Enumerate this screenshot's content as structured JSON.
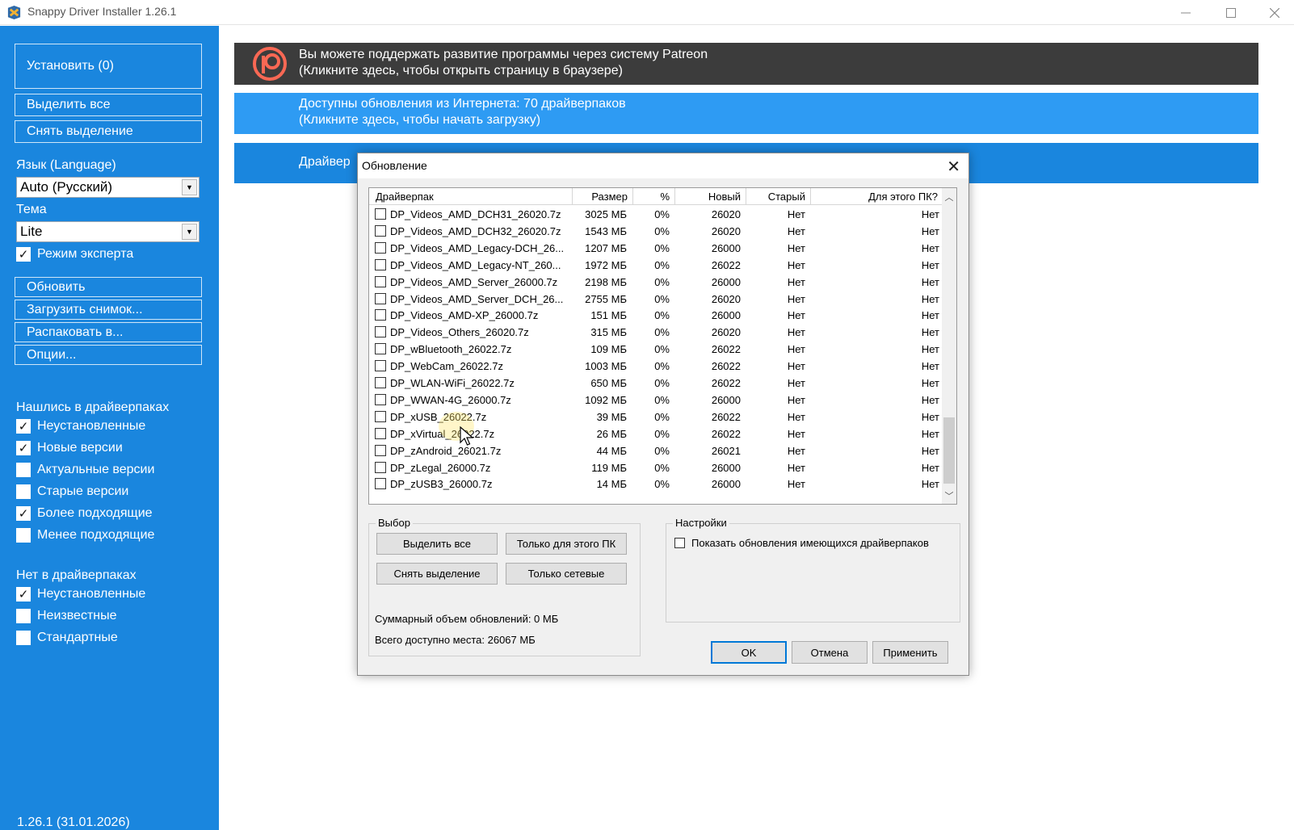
{
  "window": {
    "title": "Snappy Driver Installer 1.26.1",
    "minimize_icon": "minimize-icon",
    "maximize_icon": "maximize-icon",
    "close_icon": "close-icon"
  },
  "sidebar": {
    "install_label": "Установить (0)",
    "select_all_label": "Выделить все",
    "deselect_label": "Снять выделение",
    "language_label": "Язык (Language)",
    "language_value": "Auto (Русский)",
    "theme_label": "Тема",
    "theme_value": "Lite",
    "expert_mode_label": "Режим эксперта",
    "expert_mode_checked": true,
    "refresh_label": "Обновить",
    "load_snapshot_label": "Загрузить снимок...",
    "extract_label": "Распаковать в...",
    "options_label": "Опции...",
    "found_header": "Нашлись в драйверпаках",
    "found_filters": [
      {
        "label": "Неустановленные",
        "checked": true
      },
      {
        "label": "Новые версии",
        "checked": true
      },
      {
        "label": "Актуальные версии",
        "checked": false
      },
      {
        "label": "Старые версии",
        "checked": false
      },
      {
        "label": "Более подходящие",
        "checked": true
      },
      {
        "label": "Менее подходящие",
        "checked": false
      }
    ],
    "notfound_header": "Нет в драйверпаках",
    "notfound_filters": [
      {
        "label": "Неустановленные",
        "checked": true
      },
      {
        "label": "Неизвестные",
        "checked": false
      },
      {
        "label": "Стандартные",
        "checked": false
      }
    ],
    "version": "1.26.1 (31.01.2026)"
  },
  "banners": {
    "patreon_line1": "Вы можете поддержать развитие программы через систему Patreon",
    "patreon_line2": "(Кликните здесь, чтобы открыть страницу в браузере)",
    "updates_line1": "Доступны обновления из Интернета: 70 драйверпаков",
    "updates_line2": "(Кликните здесь, чтобы начать загрузку)",
    "drivers_partial": "Драйвер",
    "patreon_icon": "patreon-icon"
  },
  "dialog": {
    "title": "Обновление",
    "columns": [
      "Драйверпак",
      "Размер",
      "%",
      "Новый",
      "Старый",
      "Для этого ПК?"
    ],
    "rows": [
      {
        "name": "DP_Videos_AMD_DCH31_26020.7z",
        "size": "3025 МБ",
        "pct": "0%",
        "new": "26020",
        "old": "Нет",
        "pc": "Нет"
      },
      {
        "name": "DP_Videos_AMD_DCH32_26020.7z",
        "size": "1543 МБ",
        "pct": "0%",
        "new": "26020",
        "old": "Нет",
        "pc": "Нет"
      },
      {
        "name": "DP_Videos_AMD_Legacy-DCH_26...",
        "size": "1207 МБ",
        "pct": "0%",
        "new": "26000",
        "old": "Нет",
        "pc": "Нет"
      },
      {
        "name": "DP_Videos_AMD_Legacy-NT_260...",
        "size": "1972 МБ",
        "pct": "0%",
        "new": "26022",
        "old": "Нет",
        "pc": "Нет"
      },
      {
        "name": "DP_Videos_AMD_Server_26000.7z",
        "size": "2198 МБ",
        "pct": "0%",
        "new": "26000",
        "old": "Нет",
        "pc": "Нет"
      },
      {
        "name": "DP_Videos_AMD_Server_DCH_26...",
        "size": "2755 МБ",
        "pct": "0%",
        "new": "26020",
        "old": "Нет",
        "pc": "Нет"
      },
      {
        "name": "DP_Videos_AMD-XP_26000.7z",
        "size": "151 МБ",
        "pct": "0%",
        "new": "26000",
        "old": "Нет",
        "pc": "Нет"
      },
      {
        "name": "DP_Videos_Others_26020.7z",
        "size": "315 МБ",
        "pct": "0%",
        "new": "26020",
        "old": "Нет",
        "pc": "Нет"
      },
      {
        "name": "DP_wBluetooth_26022.7z",
        "size": "109 МБ",
        "pct": "0%",
        "new": "26022",
        "old": "Нет",
        "pc": "Нет"
      },
      {
        "name": "DP_WebCam_26022.7z",
        "size": "1003 МБ",
        "pct": "0%",
        "new": "26022",
        "old": "Нет",
        "pc": "Нет"
      },
      {
        "name": "DP_WLAN-WiFi_26022.7z",
        "size": "650 МБ",
        "pct": "0%",
        "new": "26022",
        "old": "Нет",
        "pc": "Нет"
      },
      {
        "name": "DP_WWAN-4G_26000.7z",
        "size": "1092 МБ",
        "pct": "0%",
        "new": "26000",
        "old": "Нет",
        "pc": "Нет"
      },
      {
        "name": "DP_xUSB_26022.7z",
        "size": "39 МБ",
        "pct": "0%",
        "new": "26022",
        "old": "Нет",
        "pc": "Нет"
      },
      {
        "name": "DP_xVirtual_26022.7z",
        "size": "26 МБ",
        "pct": "0%",
        "new": "26022",
        "old": "Нет",
        "pc": "Нет"
      },
      {
        "name": "DP_zAndroid_26021.7z",
        "size": "44 МБ",
        "pct": "0%",
        "new": "26021",
        "old": "Нет",
        "pc": "Нет"
      },
      {
        "name": "DP_zLegal_26000.7z",
        "size": "119 МБ",
        "pct": "0%",
        "new": "26000",
        "old": "Нет",
        "pc": "Нет"
      },
      {
        "name": "DP_zUSB3_26000.7z",
        "size": "14 МБ",
        "pct": "0%",
        "new": "26000",
        "old": "Нет",
        "pc": "Нет"
      }
    ],
    "selection_group": "Выбор",
    "btn_select_all": "Выделить все",
    "btn_only_this_pc": "Только для этого ПК",
    "btn_deselect": "Снять выделение",
    "btn_only_network": "Только сетевые",
    "total_updates": "Суммарный объем обновлений: 0 МБ",
    "free_space": "Всего доступно места: 26067 МБ",
    "settings_group": "Настройки",
    "show_existing_label": "Показать обновления имеющихся драйверпаков",
    "show_existing_checked": false,
    "btn_ok": "OK",
    "btn_cancel": "Отмена",
    "btn_apply": "Применить"
  },
  "colors": {
    "sidebar": "#1a86de",
    "patreon_banner": "#3c3c3c",
    "updates_banner": "#2e9bf3",
    "dialog_bg": "#f0f0f0"
  }
}
